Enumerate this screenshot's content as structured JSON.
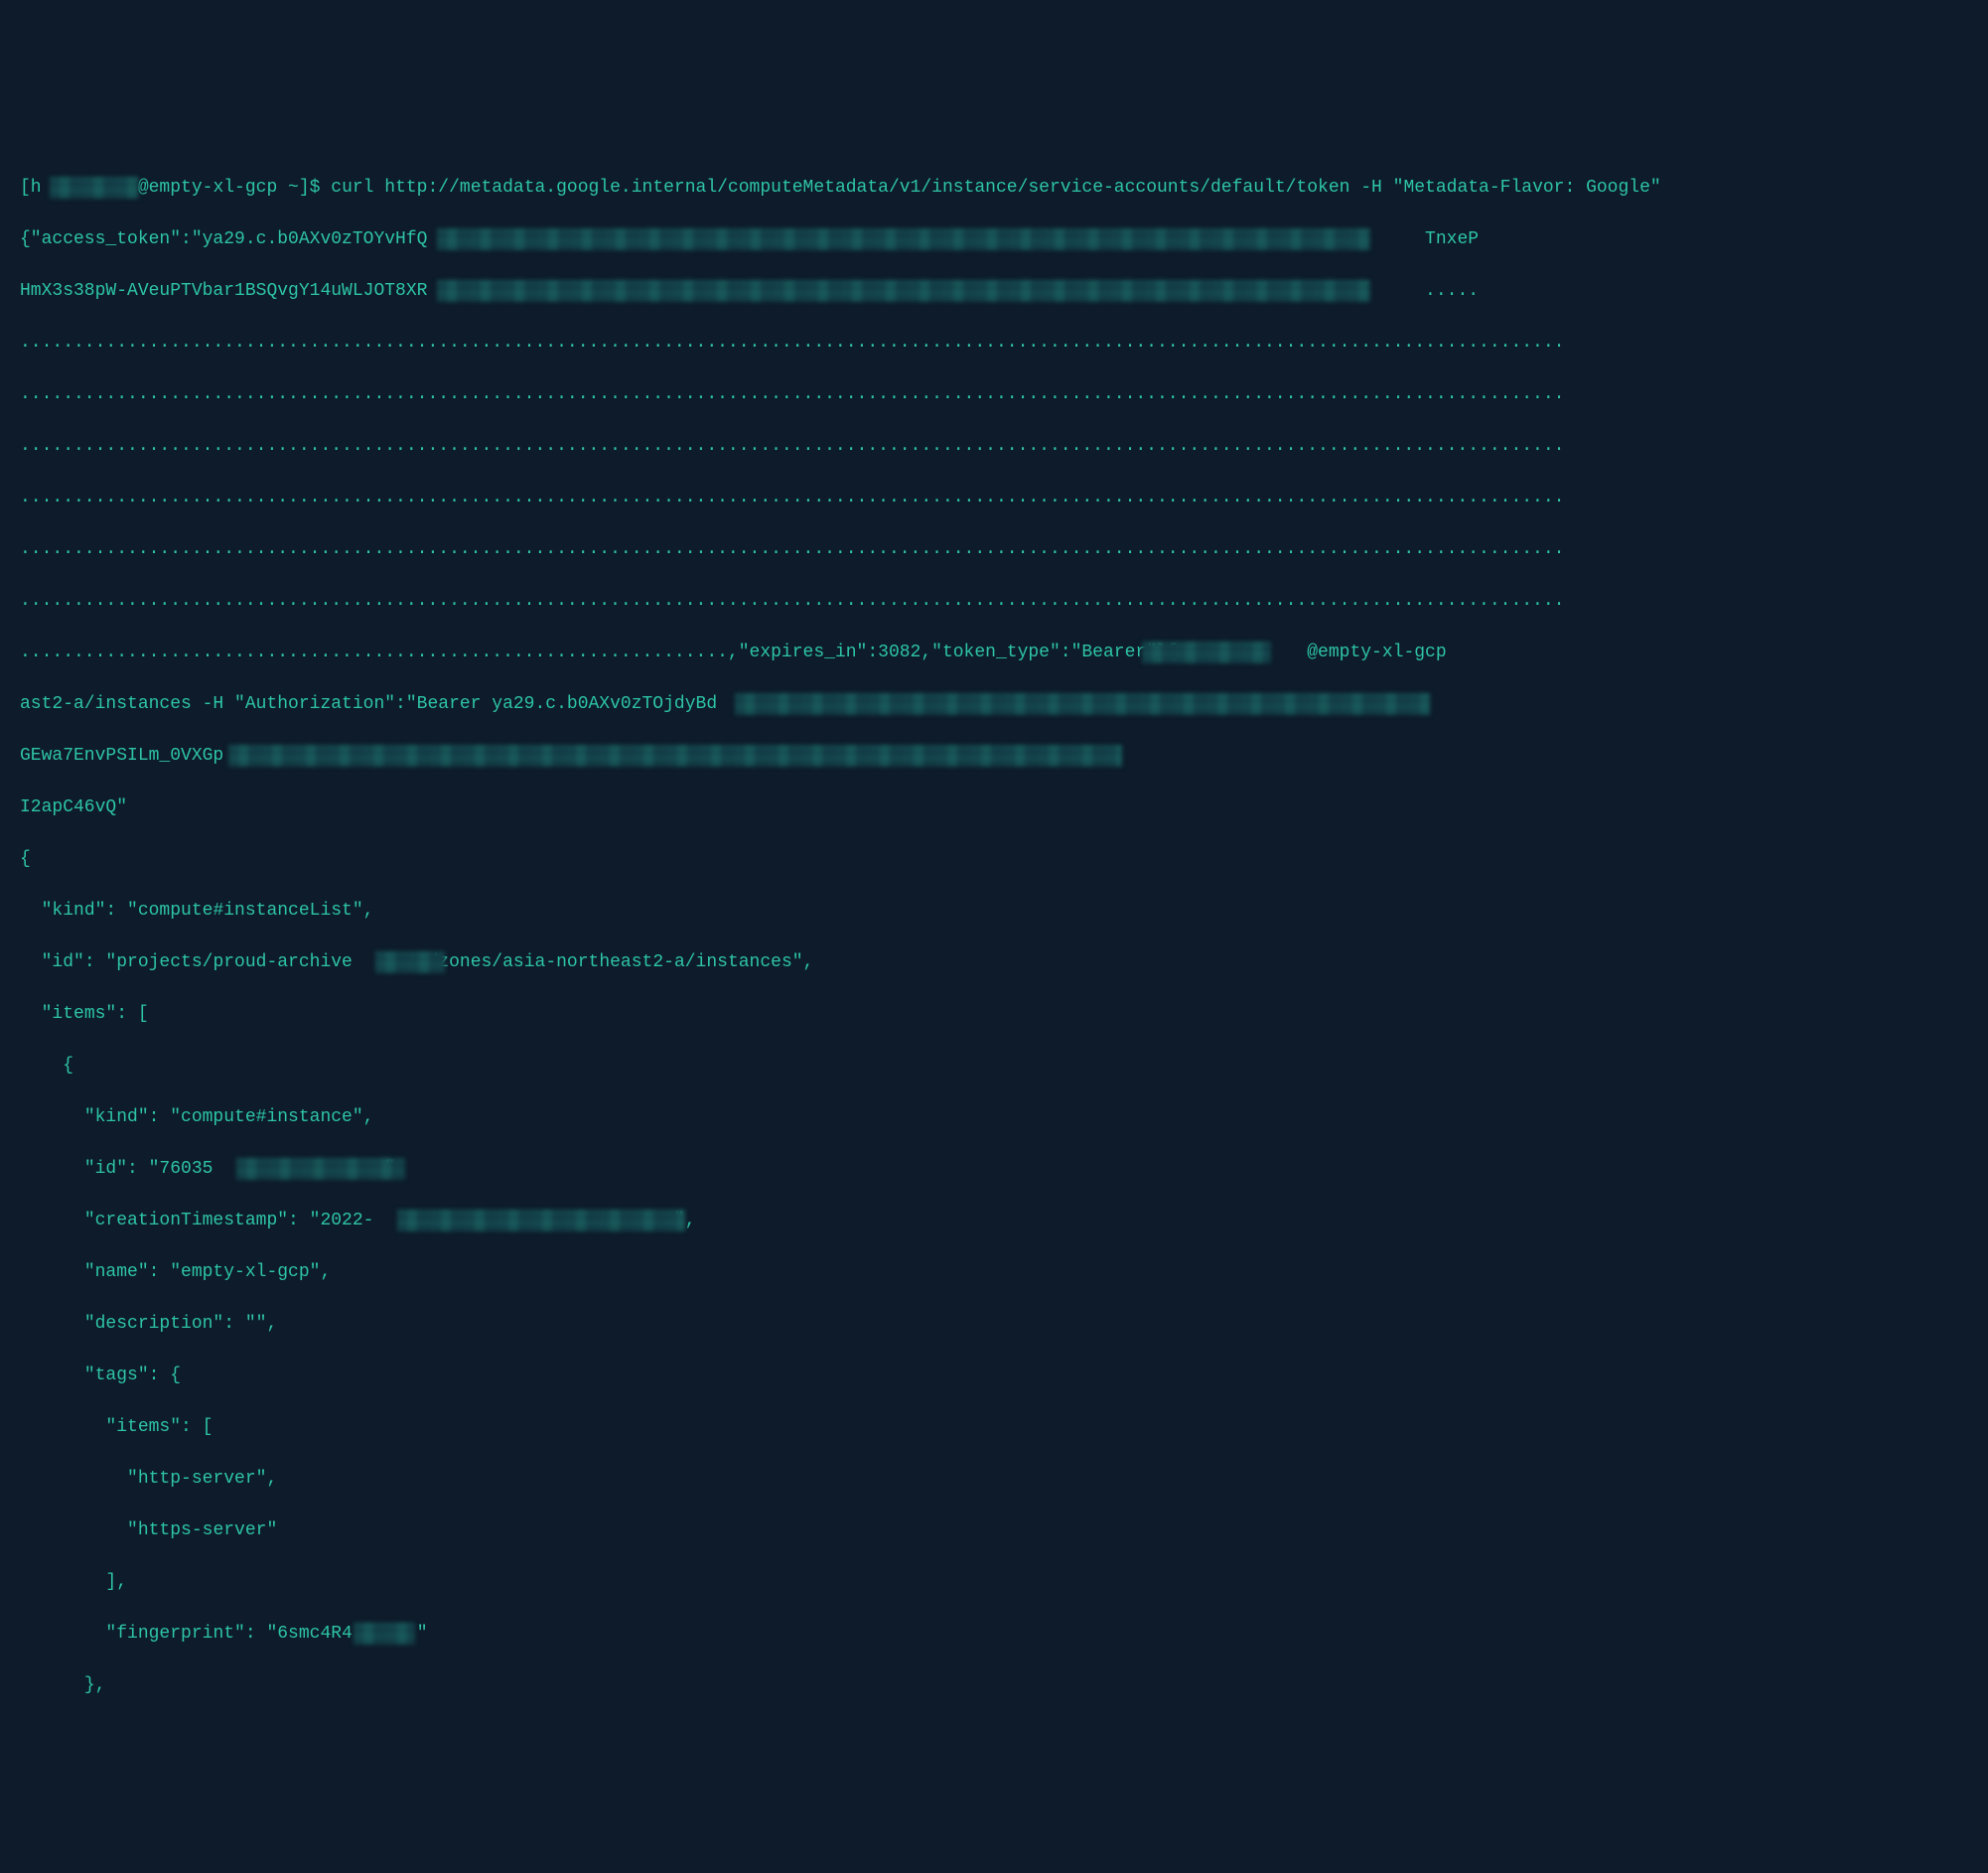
{
  "prompt1": {
    "user_open": "[h",
    "host": "@empty-xl-gcp ~]$ ",
    "cmd": "curl http://metadata.google.internal/computeMetadata/v1/instance/service-accounts/default/token -H \"Metadata-Flavor: Google\""
  },
  "token_response": {
    "prefix": "{\"access_token\":\"ya29.c.b0AXv0zTOYvHfQ",
    "line2_tail": "TnxeP",
    "line3_head": "HmX3s38pW-AVeuPTVbar1BSQvgY14uWLJOT8XR",
    "dots_tail": ".....",
    "dots_full": "................................................................................................................................................",
    "dots_partial": "..................................................................",
    "meta_tail": ",\"expires_in\":3082,\"token_type\":\"Bearer\"}[",
    "second_host": "@empty-xl-gcp"
  },
  "prompt2": {
    "line1_tail": "ast2-a/instances -H \"Authorization\":\"Bearer ya29.c.b0AXv0zTOjdyBd",
    "line2_head": "GEwa7EnvPSILm_0VXGp",
    "line3": "I2apC46vQ\""
  },
  "json_out": {
    "l1": "{",
    "l2": "  \"kind\": \"compute#instanceList\",",
    "l3a": "  \"id\": \"projects/proud-archive",
    "l3b": "/zones/asia-northeast2-a/instances\",",
    "l4": "  \"items\": [",
    "l5": "    {",
    "l6": "      \"kind\": \"compute#instance\",",
    "l7a": "      \"id\": \"76035",
    "l7b": "\",",
    "l8a": "      \"creationTimestamp\": \"2022-",
    "l8b": "\",",
    "l9": "      \"name\": \"empty-xl-gcp\",",
    "l10": "      \"description\": \"\",",
    "l11": "      \"tags\": {",
    "l12": "        \"items\": [",
    "l13": "          \"http-server\",",
    "l14": "          \"https-server\"",
    "l15": "        ],",
    "l16a": "        \"fingerprint\": \"6smc4R4",
    "l16b": "\"",
    "l17": "      },"
  }
}
